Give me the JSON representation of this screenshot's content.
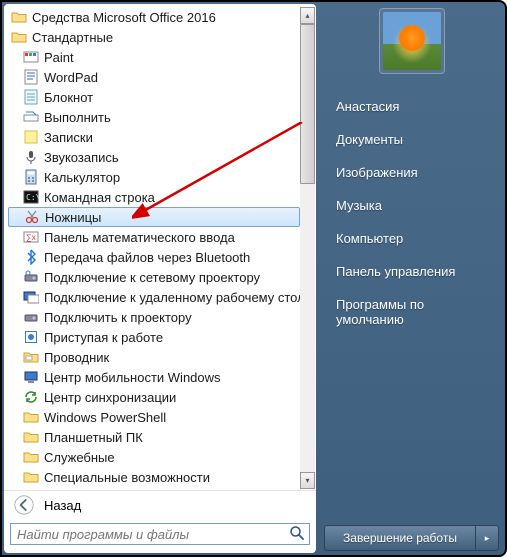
{
  "programs": {
    "folders_top": [
      {
        "label": "Средства Microsoft Office 2016"
      },
      {
        "label": "Стандартные"
      }
    ],
    "items": [
      {
        "label": "Paint",
        "icon": "paint"
      },
      {
        "label": "WordPad",
        "icon": "wordpad"
      },
      {
        "label": "Блокнот",
        "icon": "notepad"
      },
      {
        "label": "Выполнить",
        "icon": "run"
      },
      {
        "label": "Записки",
        "icon": "sticky"
      },
      {
        "label": "Звукозапись",
        "icon": "mic"
      },
      {
        "label": "Калькулятор",
        "icon": "calc"
      },
      {
        "label": "Командная строка",
        "icon": "cmd"
      },
      {
        "label": "Ножницы",
        "icon": "snip",
        "selected": true
      },
      {
        "label": "Панель математического ввода",
        "icon": "math"
      },
      {
        "label": "Передача файлов через Bluetooth",
        "icon": "bt"
      },
      {
        "label": "Подключение к сетевому проектору",
        "icon": "netproj"
      },
      {
        "label": "Подключение к удаленному рабочему столу",
        "icon": "rdp"
      },
      {
        "label": "Подключить к проектору",
        "icon": "proj"
      },
      {
        "label": "Приступая к работе",
        "icon": "welcome"
      },
      {
        "label": "Проводник",
        "icon": "explorer"
      },
      {
        "label": "Центр мобильности Windows",
        "icon": "mob"
      },
      {
        "label": "Центр синхронизации",
        "icon": "sync"
      }
    ],
    "folders_bottom": [
      {
        "label": "Windows PowerShell"
      },
      {
        "label": "Планшетный ПК"
      },
      {
        "label": "Служебные"
      },
      {
        "label": "Специальные возможности"
      }
    ]
  },
  "back_label": "Назад",
  "search_placeholder": "Найти программы и файлы",
  "right_links": [
    "Анастасия",
    "Документы",
    "Изображения",
    "Музыка",
    "Компьютер",
    "Панель управления",
    "Программы по умолчанию"
  ],
  "shutdown_label": "Завершение работы"
}
